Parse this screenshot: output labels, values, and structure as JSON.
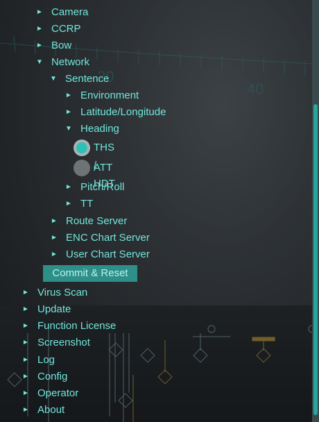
{
  "menu": {
    "items": [
      {
        "label": "Camera",
        "expanded": false
      },
      {
        "label": "CCRP",
        "expanded": false
      },
      {
        "label": "Bow",
        "expanded": false
      },
      {
        "label": "Network",
        "expanded": true
      },
      {
        "label": "Sentence",
        "expanded": true
      },
      {
        "label": "Environment",
        "expanded": false
      },
      {
        "label": "Latitude/Longitude",
        "expanded": false
      },
      {
        "label": "Heading",
        "expanded": true
      },
      {
        "label": "Pitch/Roll",
        "expanded": false
      },
      {
        "label": "TT",
        "expanded": false
      },
      {
        "label": "Route Server",
        "expanded": false
      },
      {
        "label": "ENC Chart Server",
        "expanded": false
      },
      {
        "label": "User Chart Server",
        "expanded": false
      },
      {
        "label": "Virus Scan",
        "expanded": false
      },
      {
        "label": "Update",
        "expanded": false
      },
      {
        "label": "Function License",
        "expanded": false
      },
      {
        "label": "Screenshot",
        "expanded": false
      },
      {
        "label": "Log",
        "expanded": false
      },
      {
        "label": "Config",
        "expanded": false
      },
      {
        "label": "Operator",
        "expanded": false
      },
      {
        "label": "About",
        "expanded": false
      }
    ],
    "heading_options": [
      {
        "label": "THS / HDT",
        "selected": true
      },
      {
        "label": "ATT",
        "selected": false
      }
    ],
    "commit_label": "Commit & Reset",
    "arrow_collapsed": "►",
    "arrow_expanded": "▼"
  },
  "background": {
    "scale_labels": [
      "20",
      "40"
    ]
  },
  "colors": {
    "text": "#73e6dc",
    "accent": "#2cc0b6",
    "button_bg": "#2e8f89"
  }
}
